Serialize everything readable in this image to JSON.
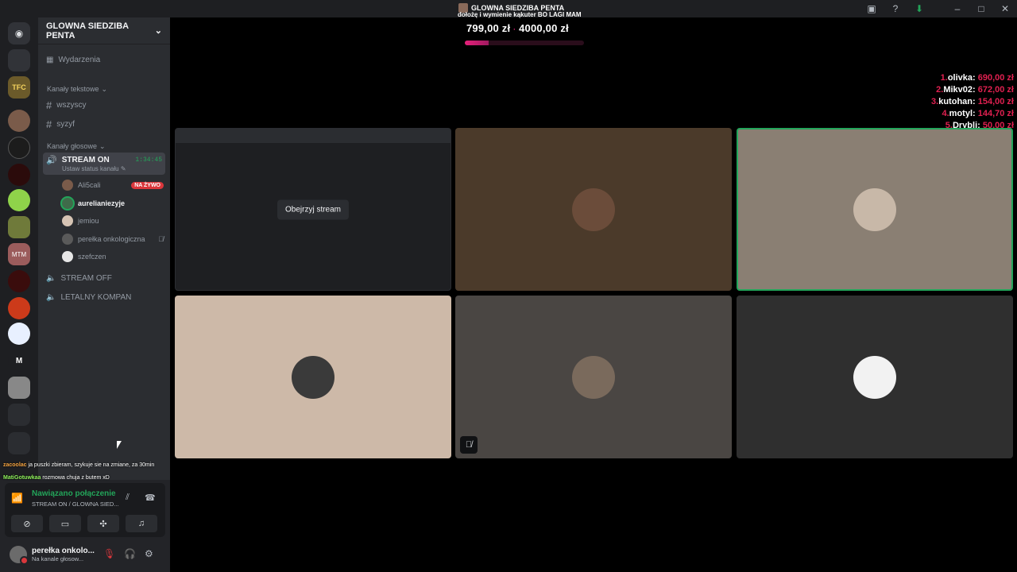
{
  "window": {
    "title": "GLOWNA SIEDZIBA PENTA",
    "icons": [
      "inbox-icon",
      "help-icon",
      "download-icon",
      "minimize-icon",
      "maximize-icon",
      "close-icon"
    ]
  },
  "servers": {
    "items": [
      "discord-home",
      "server-1",
      "TFC",
      "server-3",
      "server-4",
      "server-5",
      "server-6",
      "server-7",
      "MTM",
      "server-9",
      "server-10",
      "server-11",
      "M",
      "server-13",
      "server-14",
      "server-15"
    ]
  },
  "sidebar": {
    "guild_name": "GLOWNA SIEDZIBA PENTA",
    "events_label": "Wydarzenia",
    "text_category": "Kanały tekstowe",
    "text_channels": [
      "wszyscy",
      "syzyf"
    ],
    "voice_category": "Kanały głosowe",
    "active_voice": {
      "name": "STREAM ON",
      "time": "1:34:45",
      "status": "Ustaw status kanału"
    },
    "members": [
      {
        "name": "Ali5cali",
        "badge": "NA ŻYWO"
      },
      {
        "name": "aurelianiezyje",
        "badge": ""
      },
      {
        "name": "jemiou",
        "badge": ""
      },
      {
        "name": "perełka onkologiczna",
        "badge": ""
      },
      {
        "name": "szefczen",
        "badge": ""
      }
    ],
    "other_voice": [
      "STREAM OFF",
      "LETALNY KOMPAN"
    ]
  },
  "chat_overlay": [
    {
      "user": "zacoolac",
      "text": "ja puszki zbieram, szykuje sie na zmiane, za 30min"
    },
    {
      "user": "MatiGotuwkaa",
      "text": "rozmowa chuja z butem xD"
    }
  ],
  "connection": {
    "title": "Nawiązano połączenie",
    "subtitle": "STREAM ON / GLOWNA SIED..."
  },
  "user": {
    "name": "perełka onkolo...",
    "status": "Na kanale głosow..."
  },
  "overlay": {
    "donation_text": "dołożę i wymienie kąkuter BO LAGI MAM",
    "current": "799,00 zł",
    "goal": "4000,00 zł",
    "progress_fraction": 0.2,
    "leaderboard": [
      {
        "rank": "1.",
        "name": "olivka:",
        "amount": "690,00 zł"
      },
      {
        "rank": "2.",
        "name": "Mikv02:",
        "amount": "672,00 zł"
      },
      {
        "rank": "3.",
        "name": "kutohan:",
        "amount": "154,00 zł"
      },
      {
        "rank": "4.",
        "name": "motyl:",
        "amount": "144,70 zł"
      },
      {
        "rank": "5.",
        "name": "Drybli:",
        "amount": "50,00 zł"
      }
    ]
  },
  "stage": {
    "watch_button": "Obejrzyj stream",
    "tile_colors": [
      "#1e1f22",
      "#4b3a2a",
      "#8a7f73",
      "#cdb9a8",
      "#4a4643",
      "#2f2f2f"
    ]
  }
}
